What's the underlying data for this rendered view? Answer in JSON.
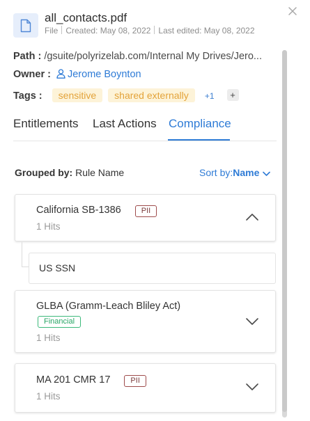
{
  "file": {
    "name": "all_contacts.pdf",
    "type": "File",
    "created": "Created: May 08, 2022",
    "edited": "Last edited: May 08, 2022"
  },
  "details": {
    "path_label": "Path :",
    "path_value": "/gsuite/polyrizelab.com/Internal My Drives/Jero...",
    "owner_label": "Owner :",
    "owner_value": "Jerome Boynton",
    "tags_label": "Tags :",
    "tags": [
      "sensitive",
      "shared externally"
    ],
    "tags_more": "+1",
    "add_tag": "+"
  },
  "tabs": [
    "Entitlements",
    "Last Actions",
    "Compliance"
  ],
  "active_tab": "Compliance",
  "grouping": {
    "label": "Grouped by:",
    "value": "Rule Name",
    "sort_label": "Sort by:",
    "sort_value": "Name"
  },
  "rules": [
    {
      "name": "California SB-1386",
      "badge": "PII",
      "hits": "1 Hits",
      "expanded": true,
      "children": [
        "US SSN"
      ]
    },
    {
      "name": "GLBA (Gramm-Leach Bliley Act)",
      "badge": "Financial",
      "hits": "1 Hits",
      "expanded": false
    },
    {
      "name": "MA 201 CMR 17",
      "badge": "PII",
      "hits": "1 Hits",
      "expanded": false
    }
  ],
  "colors": {
    "accent": "#2e7bd6",
    "tag_bg": "#fdf3d8",
    "tag_text": "#e3a33a",
    "pii_border": "#9e4b4b",
    "financial": "#27a565"
  }
}
